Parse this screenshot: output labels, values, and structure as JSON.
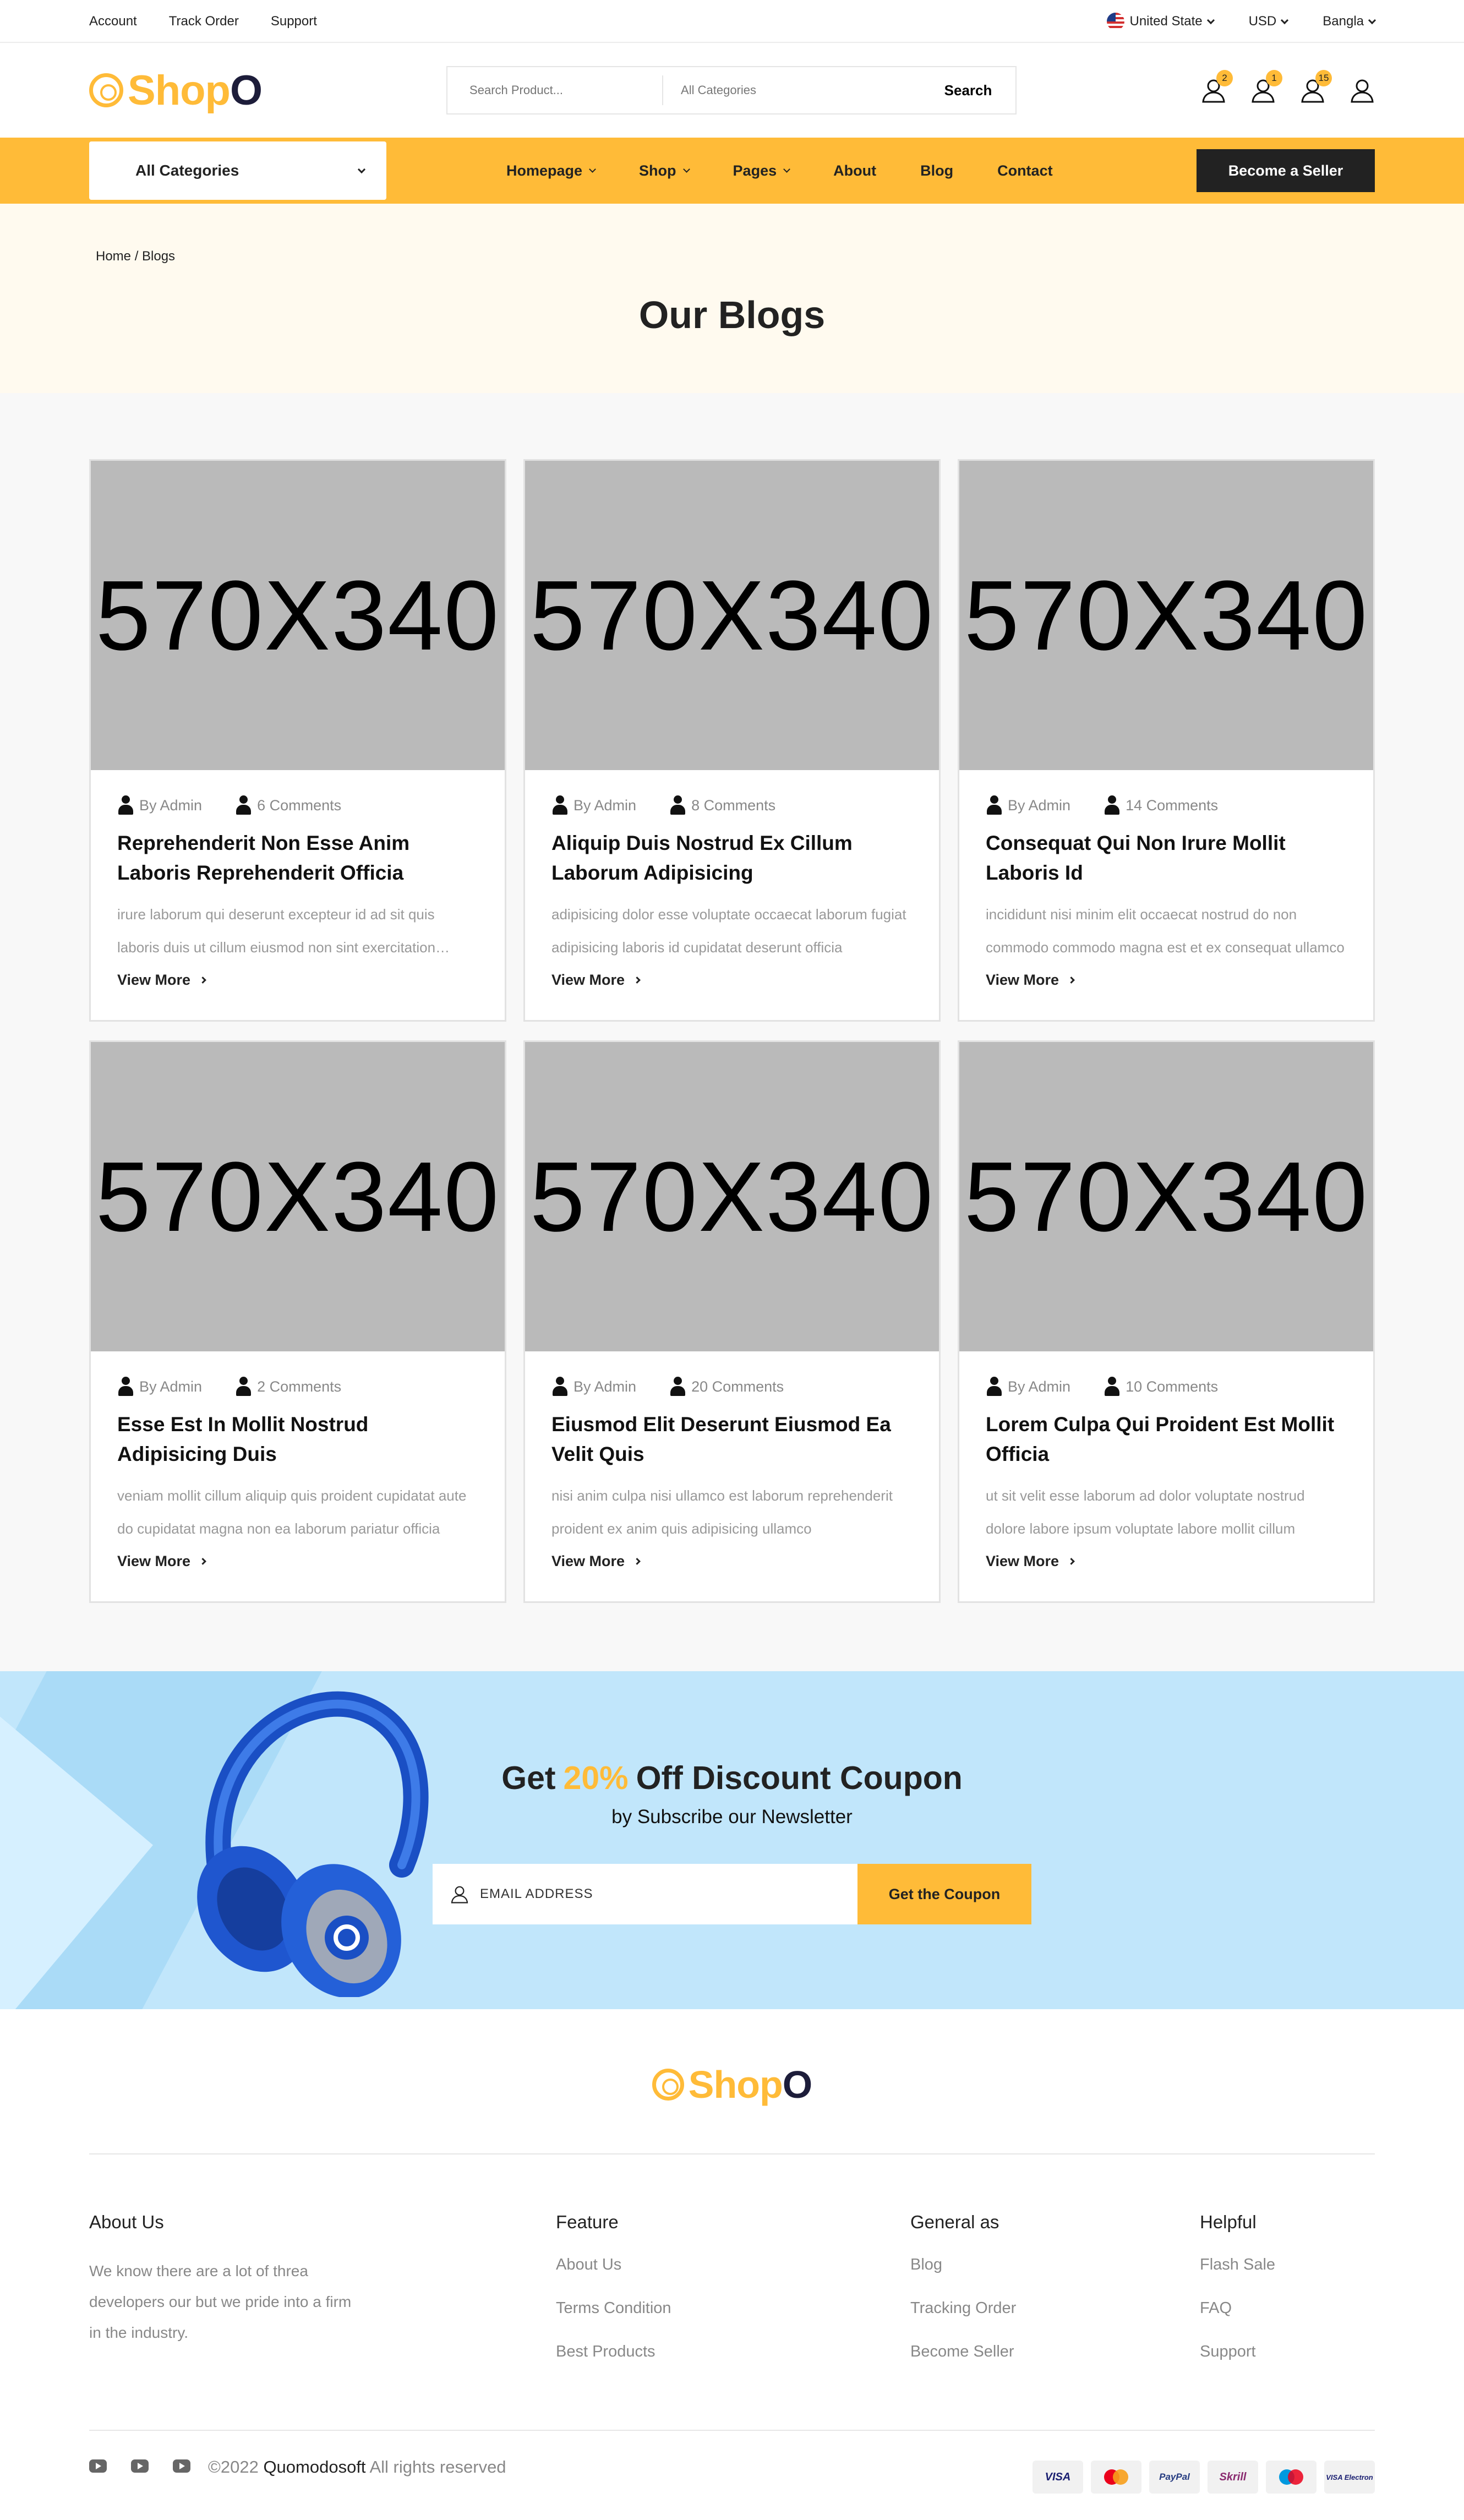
{
  "topbar": {
    "links": [
      "Account",
      "Track Order",
      "Support"
    ],
    "country": "United State",
    "currency": "USD",
    "language": "Bangla"
  },
  "header": {
    "logo_part1": "Shop",
    "logo_part2": "O",
    "search_placeholder": "Search Product...",
    "category_select": "All Categories",
    "search_button": "Search",
    "badges": {
      "compare": "2",
      "wishlist": "1",
      "cart": "15"
    }
  },
  "nav": {
    "all_categories": "All Categories",
    "menu": [
      "Homepage",
      "Shop",
      "Pages",
      "About",
      "Blog",
      "Contact"
    ],
    "seller_button": "Become a Seller"
  },
  "page": {
    "breadcrumb": "Home / Blogs",
    "title": "Our Blogs"
  },
  "blogs": [
    {
      "image": "570X340",
      "author": "By Admin",
      "comments": "6 Comments",
      "title": "Reprehenderit Non Esse Anim Laboris Reprehenderit Officia",
      "excerpt": "irure laborum qui deserunt excepteur id ad sit quis laboris duis ut cillum eiusmod non sint exercitation ullamco",
      "link": "View More"
    },
    {
      "image": "570X340",
      "author": "By Admin",
      "comments": "8 Comments",
      "title": "Aliquip Duis Nostrud Ex Cillum Laborum Adipisicing",
      "excerpt": "adipisicing dolor esse voluptate occaecat laborum fugiat adipisicing laboris id cupidatat deserunt officia",
      "link": "View More"
    },
    {
      "image": "570X340",
      "author": "By Admin",
      "comments": "14 Comments",
      "title": "Consequat Qui Non Irure Mollit Laboris Id",
      "excerpt": "incididunt nisi minim elit occaecat nostrud do non commodo commodo magna est et ex consequat ullamco",
      "link": "View More"
    },
    {
      "image": "570X340",
      "author": "By Admin",
      "comments": "2 Comments",
      "title": "Esse Est In Mollit Nostrud Adipisicing Duis",
      "excerpt": "veniam mollit cillum aliquip quis proident cupidatat aute do cupidatat magna non ea laborum pariatur officia",
      "link": "View More"
    },
    {
      "image": "570X340",
      "author": "By Admin",
      "comments": "20 Comments",
      "title": "Eiusmod Elit Deserunt Eiusmod Ea Velit Quis",
      "excerpt": "nisi anim culpa nisi ullamco est laborum reprehenderit proident ex anim quis adipisicing ullamco",
      "link": "View More"
    },
    {
      "image": "570X340",
      "author": "By Admin",
      "comments": "10 Comments",
      "title": "Lorem Culpa Qui Proident Est Mollit Officia",
      "excerpt": "ut sit velit esse laborum ad dolor voluptate nostrud dolore labore ipsum voluptate labore mollit cillum",
      "link": "View More"
    }
  ],
  "newsletter": {
    "title_before": "Get",
    "discount": "20%",
    "title_after": "Off Discount Coupon",
    "subtitle": "by Subscribe our Newsletter",
    "email_placeholder": "EMAIL ADDRESS",
    "button": "Get the Coupon"
  },
  "footer": {
    "about_title": "About Us",
    "about_text": "We know there are a lot of threa developers our but we pride into a firm in the industry.",
    "feature_title": "Feature",
    "feature_links": [
      "About Us",
      "Terms Condition",
      "Best Products"
    ],
    "general_title": "General as",
    "general_links": [
      "Blog",
      "Tracking Order",
      "Become Seller"
    ],
    "helpful_title": "Helpful",
    "helpful_links": [
      "Flash Sale",
      "FAQ",
      "Support"
    ],
    "copyright_prefix": "©2022",
    "copyright_brand": "Quomodosoft",
    "copyright_suffix": "All rights reserved",
    "payments": [
      "VISA",
      "Mastercard",
      "PayPal",
      "Skrill",
      "Maestro",
      "VISA Electron"
    ]
  },
  "colors": {
    "accent": "#ffbb38",
    "dark": "#222222",
    "newsletter_bg": "#c1e6fb",
    "hero_bg": "#fffaef"
  }
}
